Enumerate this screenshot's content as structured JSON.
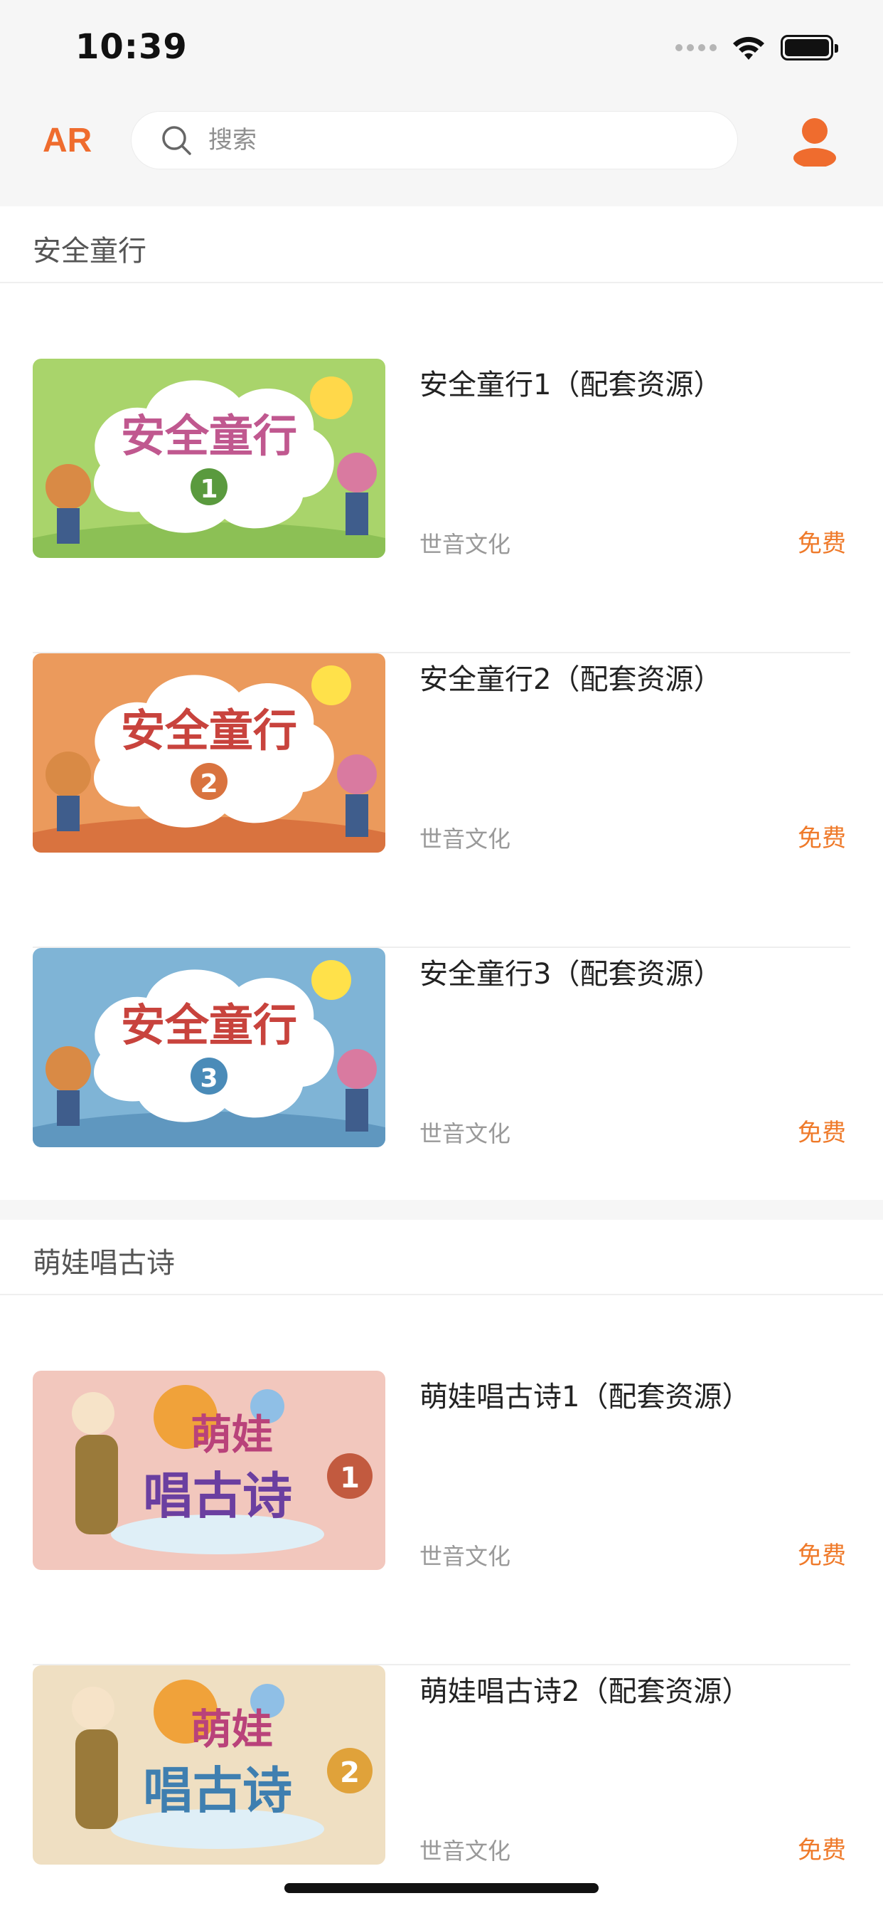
{
  "status_bar": {
    "time": "10:39"
  },
  "nav": {
    "ar_label": "AR",
    "search_placeholder": "搜索"
  },
  "sections": [
    {
      "title": "安全童行",
      "items": [
        {
          "title": "安全童行1（配套资源）",
          "publisher": "世音文化",
          "price": "免费",
          "cover_text": "安全童行",
          "cover_number": "1",
          "cover_bg": "#a9d46b"
        },
        {
          "title": "安全童行2（配套资源）",
          "publisher": "世音文化",
          "price": "免费",
          "cover_text": "安全童行",
          "cover_number": "2",
          "cover_bg": "#eb9a5c"
        },
        {
          "title": "安全童行3（配套资源）",
          "publisher": "世音文化",
          "price": "免费",
          "cover_text": "安全童行",
          "cover_number": "3",
          "cover_bg": "#7fb4d6"
        }
      ]
    },
    {
      "title": "萌娃唱古诗",
      "items": [
        {
          "title": "萌娃唱古诗1（配套资源）",
          "publisher": "世音文化",
          "price": "免费",
          "cover_text_top": "萌娃",
          "cover_text_bottom": "唱古诗",
          "cover_number": "1",
          "cover_bg": "#f2c7bd"
        },
        {
          "title": "萌娃唱古诗2（配套资源）",
          "publisher": "世音文化",
          "price": "免费",
          "cover_text_top": "萌娃",
          "cover_text_bottom": "唱古诗",
          "cover_number": "2",
          "cover_bg": "#efdfc2"
        }
      ]
    }
  ],
  "colors": {
    "accent": "#ef6c2e",
    "price": "#ef7a2a",
    "background_band": "#f6f6f6"
  },
  "icons": [
    "search-icon",
    "user-icon",
    "wifi-icon",
    "battery-icon",
    "signal-icon"
  ]
}
